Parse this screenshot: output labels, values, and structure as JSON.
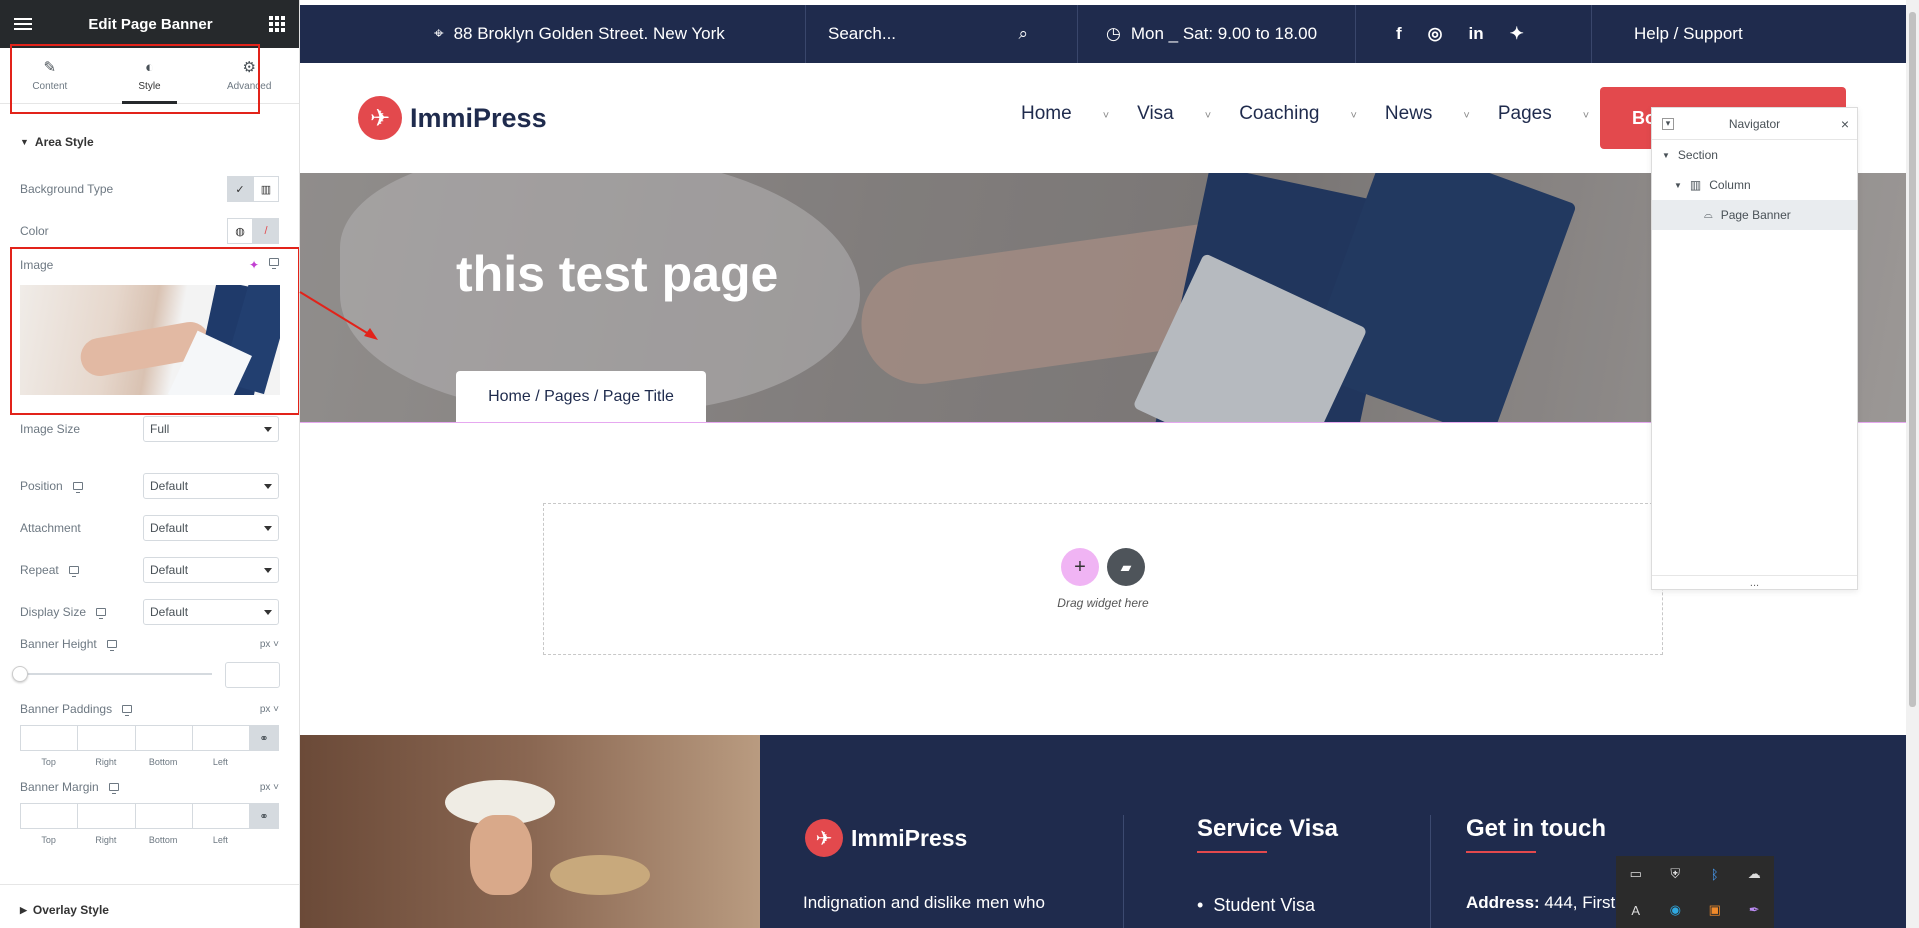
{
  "panel": {
    "title": "Edit Page Banner",
    "tabs": [
      {
        "label": "Content",
        "icon": "pencil-icon"
      },
      {
        "label": "Style",
        "icon": "half-circle-icon"
      },
      {
        "label": "Advanced",
        "icon": "gear-icon"
      }
    ],
    "area_style": "Area Style",
    "background_type": "Background Type",
    "color": "Color",
    "image": "Image",
    "image_size": {
      "label": "Image Size",
      "value": "Full"
    },
    "position": {
      "label": "Position",
      "value": "Default"
    },
    "attachment": {
      "label": "Attachment",
      "value": "Default"
    },
    "repeat": {
      "label": "Repeat",
      "value": "Default"
    },
    "display_size": {
      "label": "Display Size",
      "value": "Default"
    },
    "banner_height": {
      "label": "Banner Height",
      "unit": "px"
    },
    "banner_paddings": {
      "label": "Banner Paddings",
      "unit": "px"
    },
    "banner_margin": {
      "label": "Banner Margin",
      "unit": "px"
    },
    "dims": [
      "Top",
      "Right",
      "Bottom",
      "Left"
    ],
    "overlay_style": "Overlay Style"
  },
  "site": {
    "address": "88 Broklyn Golden Street. New York",
    "search_placeholder": "Search...",
    "hours": "Mon _ Sat: 9.00 to 18.00",
    "help": "Help / Support",
    "logo": "ImmiPress",
    "nav": [
      "Home",
      "Visa",
      "Coaching",
      "News",
      "Pages"
    ],
    "cta": "Bo",
    "banner_title": "this test page",
    "breadcrumb": "Home / Pages / Page Title",
    "drop_hint": "Drag widget here",
    "accent": "#e3494d",
    "navy": "#1f2b4d"
  },
  "footer": {
    "logo": "ImmiPress",
    "about": "Indignation and dislike men who",
    "service_title": "Service Visa",
    "service_item": "Student Visa",
    "contact_title": "Get in touch",
    "address_label": "Address:",
    "address_value": "444, First"
  },
  "navigator": {
    "title": "Navigator",
    "items": [
      "Section",
      "Column",
      "Page Banner"
    ],
    "more": "..."
  }
}
